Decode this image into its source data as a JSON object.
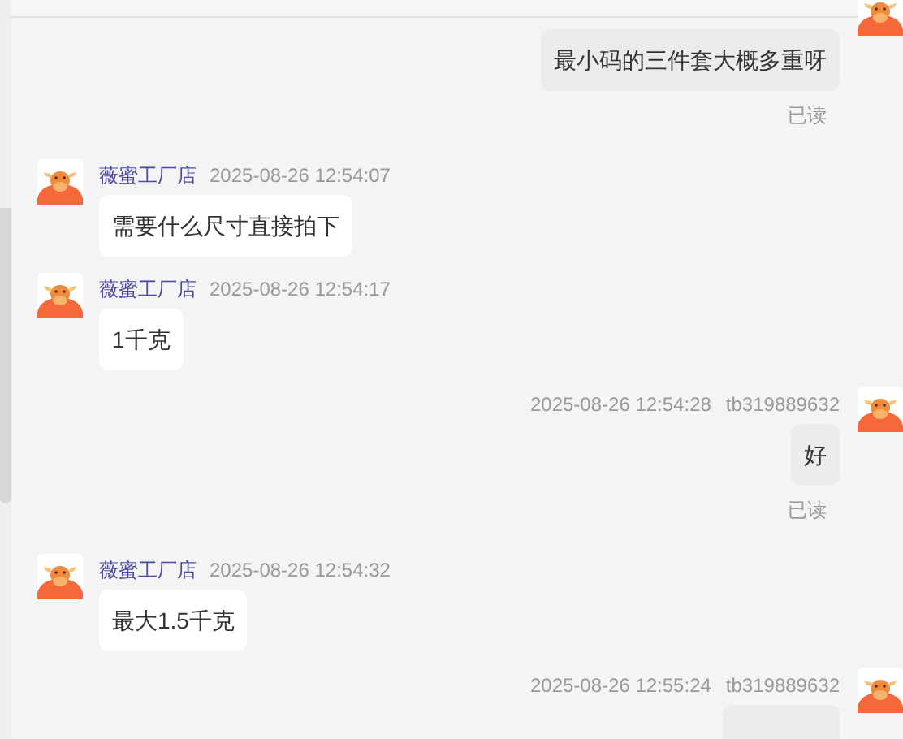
{
  "messages": [
    {
      "kind": "outgoing",
      "text": "最小码的三件套大概多重呀",
      "read_label": "已读"
    },
    {
      "kind": "incoming",
      "sender": "薇蜜工厂店",
      "time": "2025-08-26 12:54:07",
      "text": "需要什么尺寸直接拍下"
    },
    {
      "kind": "incoming",
      "sender": "薇蜜工厂店",
      "time": "2025-08-26 12:54:17",
      "text": "1千克"
    },
    {
      "kind": "outgoing",
      "sender": "tb319889632",
      "time": "2025-08-26 12:54:28",
      "text": "好",
      "read_label": "已读"
    },
    {
      "kind": "incoming",
      "sender": "薇蜜工厂店",
      "time": "2025-08-26 12:54:32",
      "text": "最大1.5千克"
    },
    {
      "kind": "outgoing",
      "sender": "tb319889632",
      "time": "2025-08-26 12:55:24"
    }
  ]
}
